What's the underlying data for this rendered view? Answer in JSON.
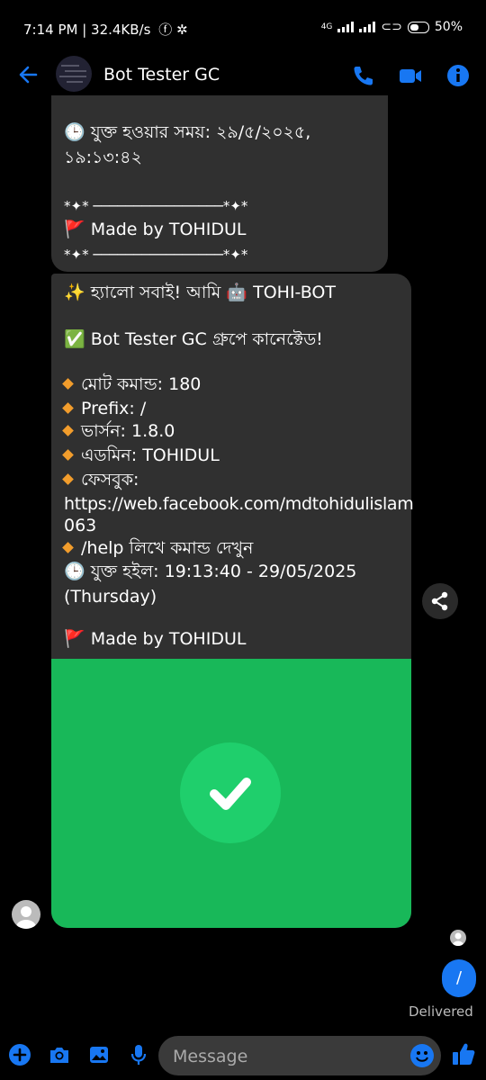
{
  "status_bar": {
    "time_speed": "7:14 PM | 32.4KB/s",
    "network": "4G",
    "battery": "50%"
  },
  "header": {
    "title": "Bot Tester GC"
  },
  "message1": {
    "lines": [
      "🕒 যুক্ত হওয়ার সময়: ২৯/৫/২০২৫,",
      "১৯:১৩:৪২",
      "*✦* ────────────────*✦*",
      "🚩 Made by TOHIDUL",
      "*✦* ────────────────*✦*"
    ]
  },
  "message2": {
    "greeting": "✨ হ্যালো সবাই! আমি 🤖 TOHI-BOT",
    "connected": "✅ Bot Tester GC গ্রুপে কানেক্টেড!",
    "items": [
      "মোট কমান্ড: 180",
      "Prefix: /",
      "ভার্সন: 1.8.0",
      "এডমিন: TOHIDUL",
      "ফেসবুক:"
    ],
    "fb_link_1": "https://web.facebook.com/mdtohidulislam",
    "fb_link_2": "063",
    "help": "/help লিখে কমান্ড দেখুন",
    "joined": "🕒 যুক্ত হইল: 19:13:40 - 29/05/2025",
    "day": "(Thursday)",
    "made_by": "🚩 Made by TOHIDUL",
    "image_color": "#18b859"
  },
  "sent_message": {
    "text": "/",
    "status": "Delivered"
  },
  "composer": {
    "placeholder": "Message"
  },
  "colors": {
    "accent": "#1877f2",
    "bubble": "#303030"
  }
}
